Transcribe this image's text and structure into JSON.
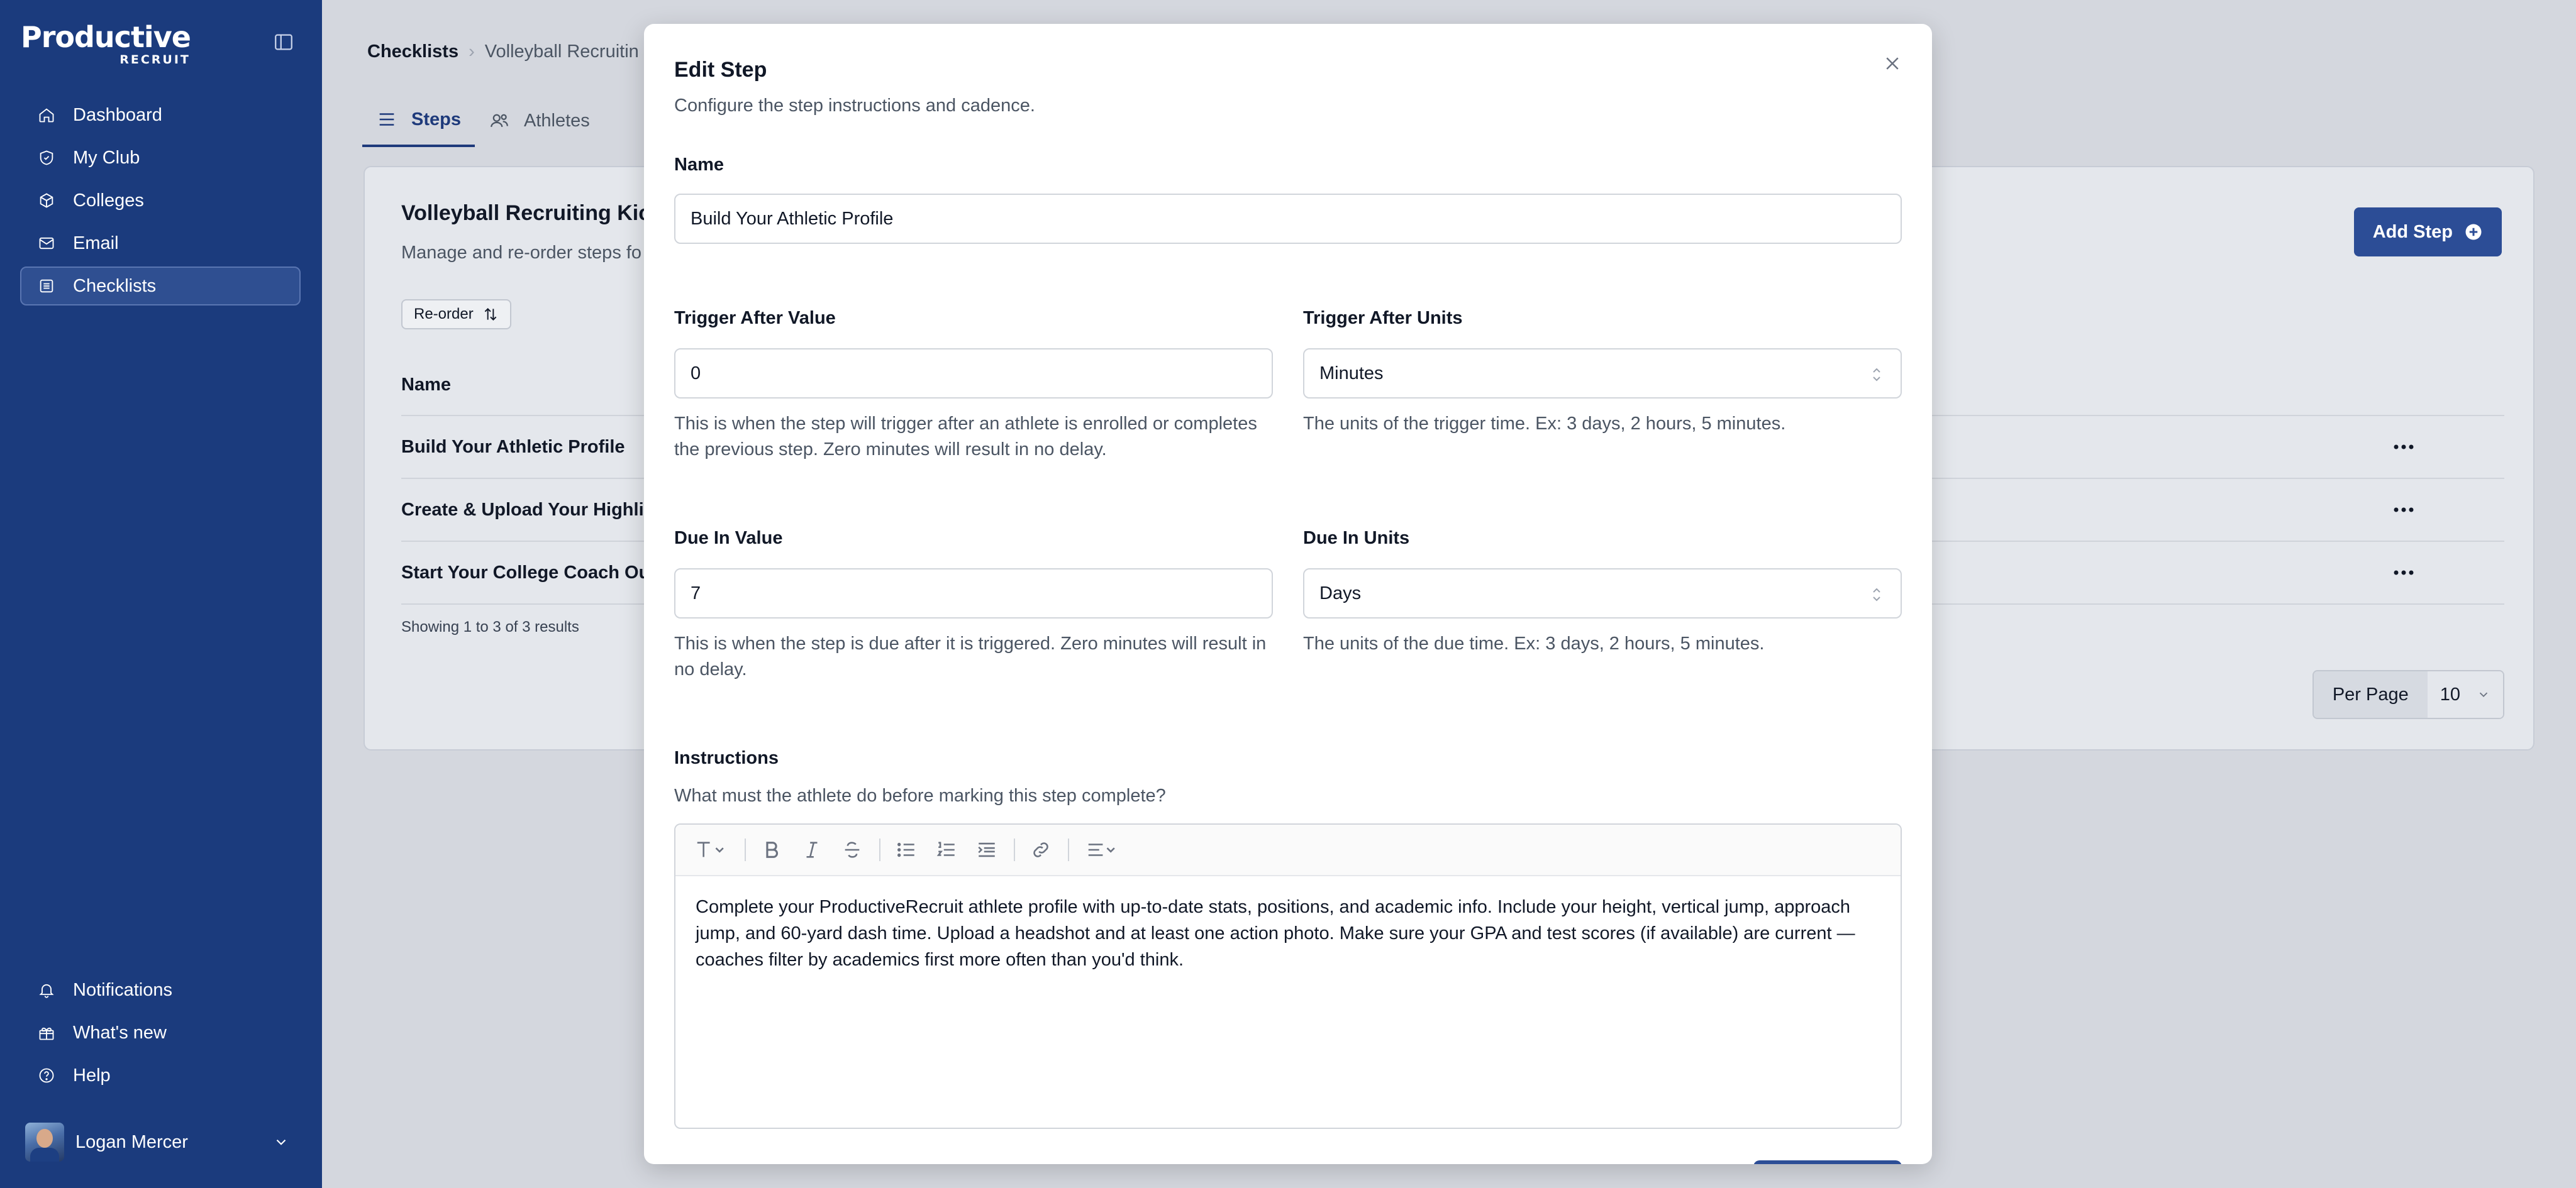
{
  "app": {
    "logo_line1": "Productive",
    "logo_line2": "RECRUIT"
  },
  "sidebar": {
    "items": [
      {
        "label": "Dashboard",
        "icon": "home-icon"
      },
      {
        "label": "My Club",
        "icon": "shield-icon"
      },
      {
        "label": "Colleges",
        "icon": "cube-icon"
      },
      {
        "label": "Email",
        "icon": "mail-icon"
      },
      {
        "label": "Checklists",
        "icon": "list-icon",
        "active": true
      }
    ],
    "bottom": [
      {
        "label": "Notifications",
        "icon": "bell-icon"
      },
      {
        "label": "What's new",
        "icon": "gift-icon"
      },
      {
        "label": "Help",
        "icon": "help-icon"
      }
    ],
    "user": {
      "name": "Logan Mercer"
    }
  },
  "breadcrumb": {
    "root": "Checklists",
    "current": "Volleyball Recruitin"
  },
  "tabs": [
    {
      "label": "Steps",
      "active": true
    },
    {
      "label": "Athletes"
    }
  ],
  "card": {
    "title": "Volleyball Recruiting Kicks",
    "subtitle": "Manage and re-order steps fo",
    "reorder_label": "Re-order",
    "add_step_label": "Add Step",
    "column_name": "Name",
    "rows": [
      "Build Your Athletic Profile",
      "Create & Upload Your Highligh",
      "Start Your College Coach Outr"
    ],
    "showing": "Showing 1 to 3 of 3 results",
    "per_page_label": "Per Page",
    "per_page_value": "10"
  },
  "modal": {
    "title": "Edit Step",
    "subtitle": "Configure the step instructions and cadence.",
    "name_label": "Name",
    "name_value": "Build Your Athletic Profile",
    "trigger_value_label": "Trigger After Value",
    "trigger_value": "0",
    "trigger_value_help": "This is when the step will trigger after an athlete is enrolled or completes the previous step. Zero minutes will result in no delay.",
    "trigger_units_label": "Trigger After Units",
    "trigger_units": "Minutes",
    "trigger_units_help": "The units of the trigger time. Ex: 3 days, 2 hours, 5 minutes.",
    "due_value_label": "Due In Value",
    "due_value": "7",
    "due_value_help": "This is when the step is due after it is triggered. Zero minutes will result in no delay.",
    "due_units_label": "Due In Units",
    "due_units": "Days",
    "due_units_help": "The units of the due time. Ex: 3 days, 2 hours, 5 minutes.",
    "instructions_label": "Instructions",
    "instructions_help": "What must the athlete do before marking this step complete?",
    "instructions_text": "Complete your ProductiveRecruit athlete profile with up-to-date stats, positions, and academic info. Include your height, vertical jump, approach jump, and 60-yard dash time. Upload a headshot and at least one action photo. Make sure your GPA and test scores (if available) are current — coaches filter by academics first more often than you'd think."
  }
}
